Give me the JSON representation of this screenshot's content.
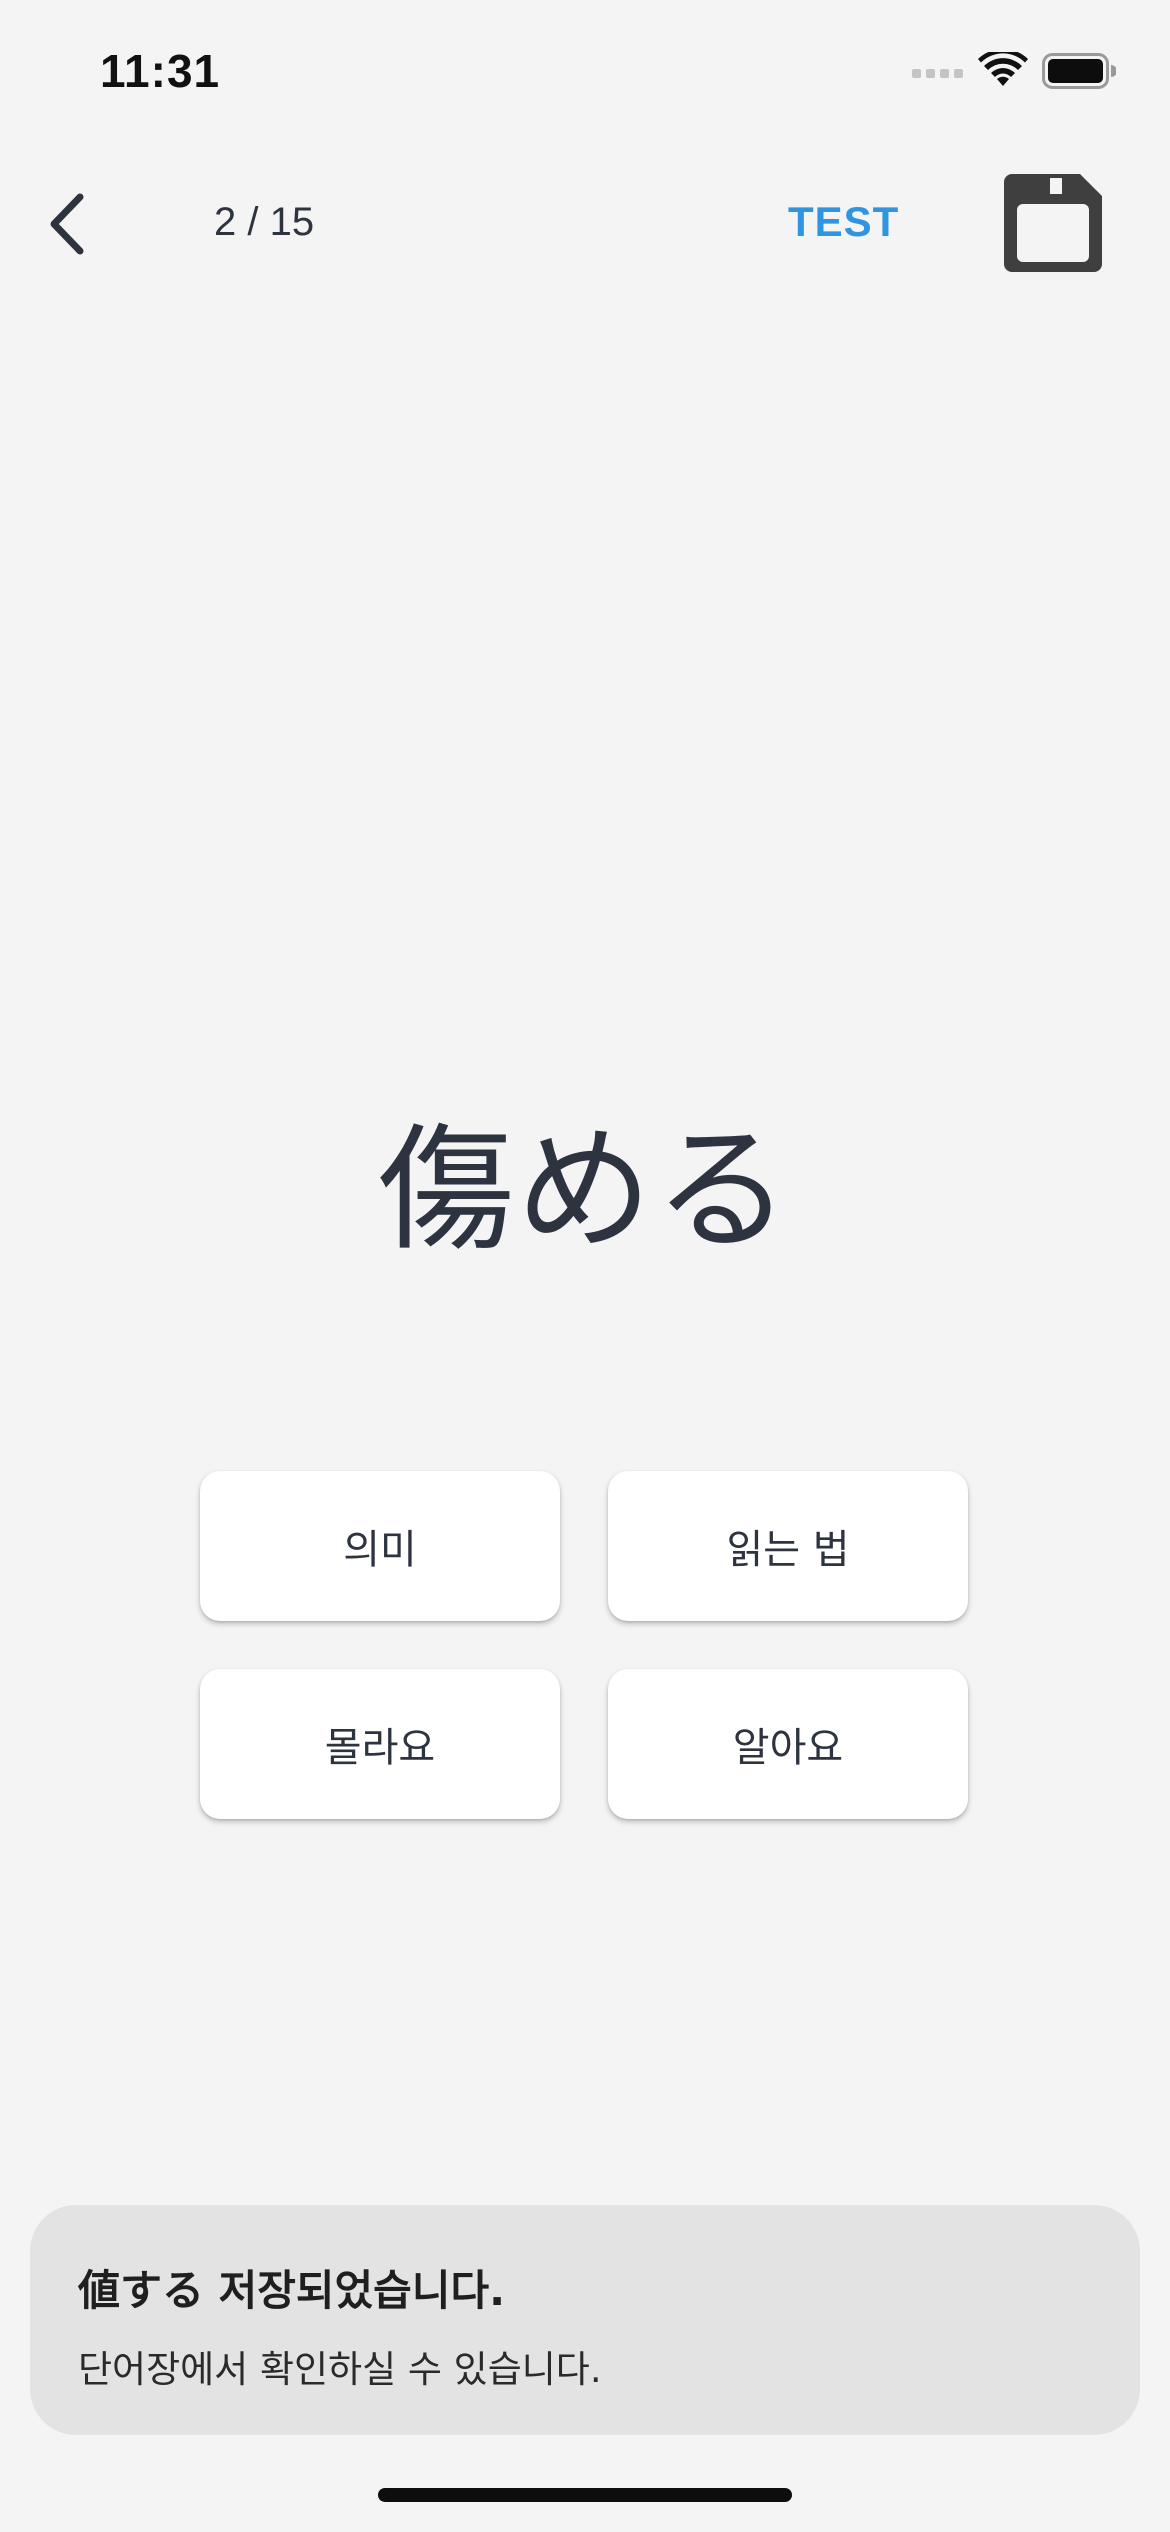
{
  "status_bar": {
    "time": "11:31",
    "icons": [
      "cellular-signal-icon",
      "wifi-icon",
      "battery-icon"
    ]
  },
  "nav": {
    "back_icon": "chevron-left-icon",
    "progress": "2 / 15",
    "test_label": "TEST",
    "save_icon": "floppy-disk-icon",
    "accent_color": "#2f95e0"
  },
  "card": {
    "word": "傷める"
  },
  "buttons": {
    "meaning": "의미",
    "reading": "읽는 법",
    "dont_know": "몰라요",
    "know": "알아요"
  },
  "toast": {
    "title": "値する 저장되었습니다.",
    "message": "단어장에서 확인하실 수 있습니다."
  }
}
